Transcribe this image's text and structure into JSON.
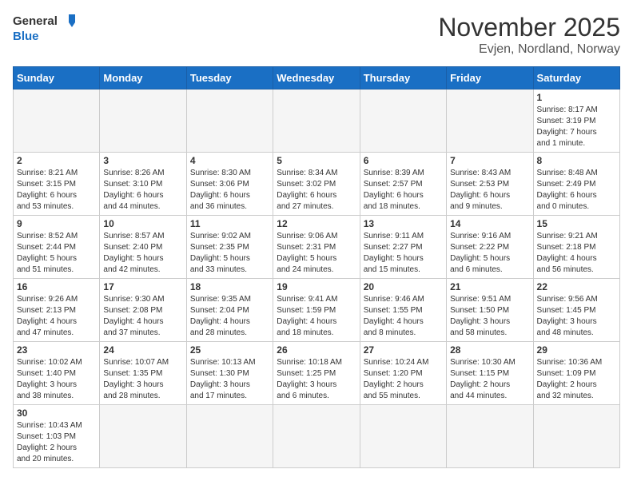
{
  "header": {
    "logo_general": "General",
    "logo_blue": "Blue",
    "month_title": "November 2025",
    "location": "Evjen, Nordland, Norway"
  },
  "weekdays": [
    "Sunday",
    "Monday",
    "Tuesday",
    "Wednesday",
    "Thursday",
    "Friday",
    "Saturday"
  ],
  "weeks": [
    [
      {
        "day": "",
        "text": ""
      },
      {
        "day": "",
        "text": ""
      },
      {
        "day": "",
        "text": ""
      },
      {
        "day": "",
        "text": ""
      },
      {
        "day": "",
        "text": ""
      },
      {
        "day": "",
        "text": ""
      },
      {
        "day": "1",
        "text": "Sunrise: 8:17 AM\nSunset: 3:19 PM\nDaylight: 7 hours\nand 1 minute."
      }
    ],
    [
      {
        "day": "2",
        "text": "Sunrise: 8:21 AM\nSunset: 3:15 PM\nDaylight: 6 hours\nand 53 minutes."
      },
      {
        "day": "3",
        "text": "Sunrise: 8:26 AM\nSunset: 3:10 PM\nDaylight: 6 hours\nand 44 minutes."
      },
      {
        "day": "4",
        "text": "Sunrise: 8:30 AM\nSunset: 3:06 PM\nDaylight: 6 hours\nand 36 minutes."
      },
      {
        "day": "5",
        "text": "Sunrise: 8:34 AM\nSunset: 3:02 PM\nDaylight: 6 hours\nand 27 minutes."
      },
      {
        "day": "6",
        "text": "Sunrise: 8:39 AM\nSunset: 2:57 PM\nDaylight: 6 hours\nand 18 minutes."
      },
      {
        "day": "7",
        "text": "Sunrise: 8:43 AM\nSunset: 2:53 PM\nDaylight: 6 hours\nand 9 minutes."
      },
      {
        "day": "8",
        "text": "Sunrise: 8:48 AM\nSunset: 2:49 PM\nDaylight: 6 hours\nand 0 minutes."
      }
    ],
    [
      {
        "day": "9",
        "text": "Sunrise: 8:52 AM\nSunset: 2:44 PM\nDaylight: 5 hours\nand 51 minutes."
      },
      {
        "day": "10",
        "text": "Sunrise: 8:57 AM\nSunset: 2:40 PM\nDaylight: 5 hours\nand 42 minutes."
      },
      {
        "day": "11",
        "text": "Sunrise: 9:02 AM\nSunset: 2:35 PM\nDaylight: 5 hours\nand 33 minutes."
      },
      {
        "day": "12",
        "text": "Sunrise: 9:06 AM\nSunset: 2:31 PM\nDaylight: 5 hours\nand 24 minutes."
      },
      {
        "day": "13",
        "text": "Sunrise: 9:11 AM\nSunset: 2:27 PM\nDaylight: 5 hours\nand 15 minutes."
      },
      {
        "day": "14",
        "text": "Sunrise: 9:16 AM\nSunset: 2:22 PM\nDaylight: 5 hours\nand 6 minutes."
      },
      {
        "day": "15",
        "text": "Sunrise: 9:21 AM\nSunset: 2:18 PM\nDaylight: 4 hours\nand 56 minutes."
      }
    ],
    [
      {
        "day": "16",
        "text": "Sunrise: 9:26 AM\nSunset: 2:13 PM\nDaylight: 4 hours\nand 47 minutes."
      },
      {
        "day": "17",
        "text": "Sunrise: 9:30 AM\nSunset: 2:08 PM\nDaylight: 4 hours\nand 37 minutes."
      },
      {
        "day": "18",
        "text": "Sunrise: 9:35 AM\nSunset: 2:04 PM\nDaylight: 4 hours\nand 28 minutes."
      },
      {
        "day": "19",
        "text": "Sunrise: 9:41 AM\nSunset: 1:59 PM\nDaylight: 4 hours\nand 18 minutes."
      },
      {
        "day": "20",
        "text": "Sunrise: 9:46 AM\nSunset: 1:55 PM\nDaylight: 4 hours\nand 8 minutes."
      },
      {
        "day": "21",
        "text": "Sunrise: 9:51 AM\nSunset: 1:50 PM\nDaylight: 3 hours\nand 58 minutes."
      },
      {
        "day": "22",
        "text": "Sunrise: 9:56 AM\nSunset: 1:45 PM\nDaylight: 3 hours\nand 48 minutes."
      }
    ],
    [
      {
        "day": "23",
        "text": "Sunrise: 10:02 AM\nSunset: 1:40 PM\nDaylight: 3 hours\nand 38 minutes."
      },
      {
        "day": "24",
        "text": "Sunrise: 10:07 AM\nSunset: 1:35 PM\nDaylight: 3 hours\nand 28 minutes."
      },
      {
        "day": "25",
        "text": "Sunrise: 10:13 AM\nSunset: 1:30 PM\nDaylight: 3 hours\nand 17 minutes."
      },
      {
        "day": "26",
        "text": "Sunrise: 10:18 AM\nSunset: 1:25 PM\nDaylight: 3 hours\nand 6 minutes."
      },
      {
        "day": "27",
        "text": "Sunrise: 10:24 AM\nSunset: 1:20 PM\nDaylight: 2 hours\nand 55 minutes."
      },
      {
        "day": "28",
        "text": "Sunrise: 10:30 AM\nSunset: 1:15 PM\nDaylight: 2 hours\nand 44 minutes."
      },
      {
        "day": "29",
        "text": "Sunrise: 10:36 AM\nSunset: 1:09 PM\nDaylight: 2 hours\nand 32 minutes."
      }
    ],
    [
      {
        "day": "30",
        "text": "Sunrise: 10:43 AM\nSunset: 1:03 PM\nDaylight: 2 hours\nand 20 minutes."
      },
      {
        "day": "",
        "text": ""
      },
      {
        "day": "",
        "text": ""
      },
      {
        "day": "",
        "text": ""
      },
      {
        "day": "",
        "text": ""
      },
      {
        "day": "",
        "text": ""
      },
      {
        "day": "",
        "text": ""
      }
    ]
  ]
}
